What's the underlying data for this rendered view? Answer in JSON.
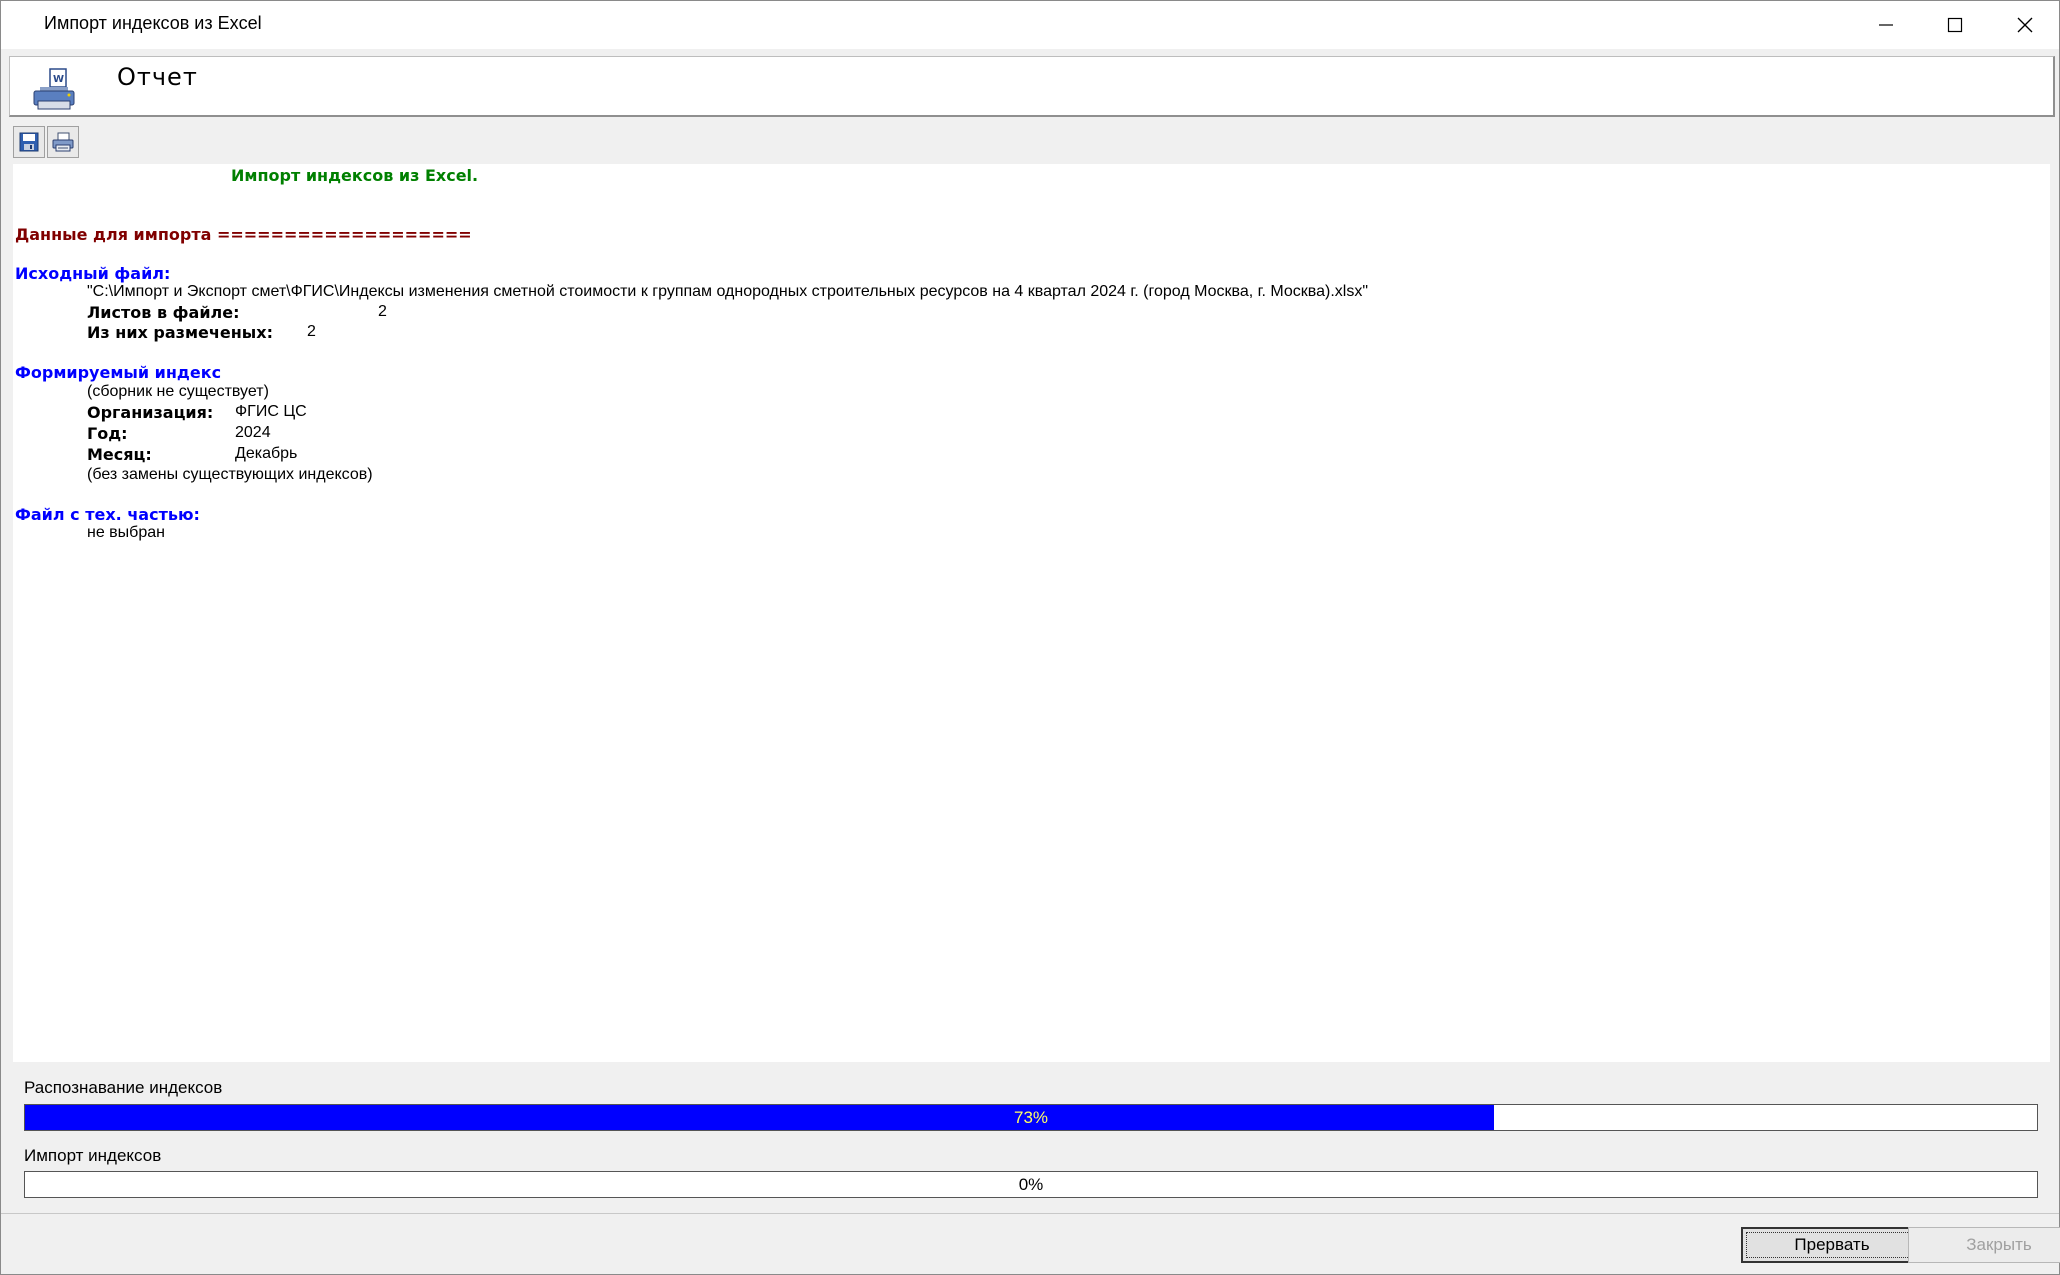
{
  "window": {
    "title": "Импорт индексов из Excel"
  },
  "header": {
    "title": "Отчет",
    "icon": "printer-report-icon"
  },
  "toolbar": {
    "buttons": [
      {
        "icon": "save-icon"
      },
      {
        "icon": "print-icon"
      }
    ]
  },
  "report": {
    "heading": "Импорт индексов из Excel.",
    "section_data": "Данные для импорта ===================",
    "source_file_label": "Исходный файл:",
    "source_file_path": "\"C:\\Импорт и Экспорт смет\\ФГИС\\Индексы изменения сметной стоимости к группам однородных строительных ресурсов на 4 квартал 2024 г. (город Москва, г. Москва).xlsx\"",
    "sheets_label": "Листов в файле:",
    "sheets_value": "2",
    "marked_label": "Из них размеченых:",
    "marked_value": "2",
    "index_label": "Формируемый индекс",
    "index_note": "(сборник не существует)",
    "org_label": "Организация:",
    "org_value": "ФГИС ЦС",
    "year_label": "Год:",
    "year_value": "2024",
    "month_label": "Месяц:",
    "month_value": "Декабрь",
    "replace_note": "(без замены существующих индексов)",
    "tech_label": "Файл с тех. частью:",
    "tech_value": "не выбран"
  },
  "progress": {
    "recognition_label": "Распознавание индексов",
    "recognition_percent": 73,
    "recognition_text": "73%",
    "import_label": "Импорт индексов",
    "import_percent": 0,
    "import_text": "0%"
  },
  "buttons": {
    "abort": "Прервать",
    "close": "Закрыть"
  },
  "colors": {
    "progress_fill": "#0000ff",
    "heading": "#008000",
    "section": "#800000",
    "label": "#0000ff"
  }
}
